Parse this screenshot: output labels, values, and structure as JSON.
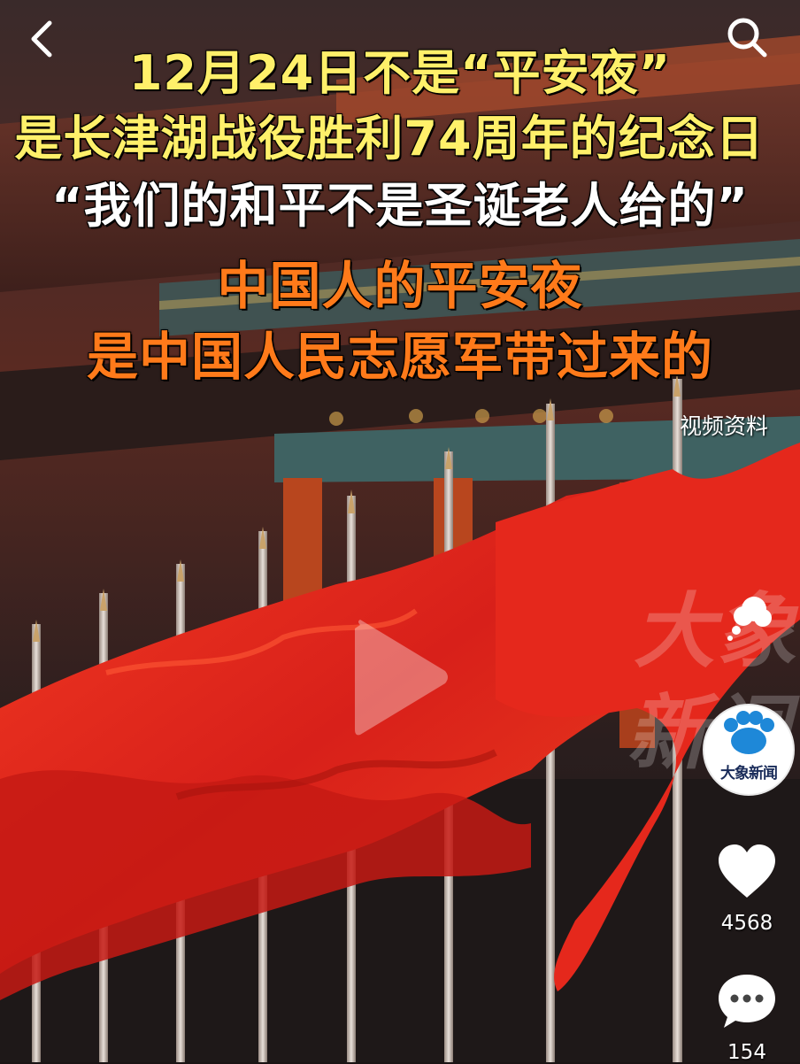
{
  "headline": {
    "line1": "12月24日不是“平安夜”",
    "line2": "是长津湖战役胜利74周年的纪念日",
    "line3": "“我们的和平不是圣诞老人给的”",
    "line4": "中国人的平安夜",
    "line5": "是中国人民志愿军带过来的"
  },
  "video": {
    "source_label": "视频资料",
    "watermark_text": "大象新闻"
  },
  "account": {
    "avatar_text": "大象新闻"
  },
  "actions": {
    "like_count": "4568",
    "comment_count": "154"
  },
  "icons": {
    "back": "chevron-left-icon",
    "search": "search-icon",
    "play": "play-icon",
    "like": "heart-icon",
    "comment": "comment-icon",
    "bubble": "thought-bubble-icon"
  },
  "colors": {
    "headline_yellow": "#fff06a",
    "headline_orange": "#ff7a1a",
    "flag_red": "#e5281c"
  }
}
